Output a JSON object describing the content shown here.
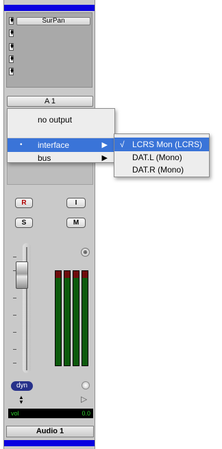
{
  "strip": {
    "insert_slot_label": "SurPan",
    "io_label": "A 1",
    "buttons": {
      "record": "R",
      "input": "I",
      "solo": "S",
      "mute": "M"
    },
    "dyn_label": "dyn",
    "vol_label": "vol",
    "vol_value": "0.0",
    "track_name": "Audio 1"
  },
  "output_menu": {
    "items": [
      {
        "label": "no output"
      },
      {
        "label": "interface",
        "selected": true,
        "has_submenu": true
      },
      {
        "label": "bus",
        "has_submenu": true
      }
    ],
    "submenu_arrow": "▶",
    "selected_bullet": "•"
  },
  "interface_submenu": {
    "check_mark": "√",
    "items": [
      {
        "label": "LCRS Mon (LCRS)",
        "checked": true
      },
      {
        "label": "DAT.L (Mono)"
      },
      {
        "label": "DAT.R (Mono)"
      }
    ]
  },
  "colors": {
    "accent_blue": "#3a74d8",
    "strip_blue_bar": "#0a00e0",
    "meter_green": "#0c5a0c",
    "display_green": "#2fd12f"
  },
  "icons": [
    "selector-arrows-icon",
    "pan-knob-icon",
    "play-triangle-icon",
    "submenu-arrow-icon",
    "check-mark-icon"
  ]
}
